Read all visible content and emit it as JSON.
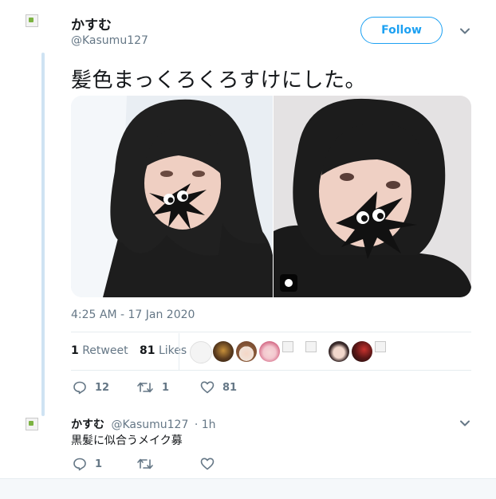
{
  "tweet": {
    "name": "かすむ",
    "handle": "@Kasumu127",
    "follow_label": "Follow",
    "text": "髪色まっくろくろすけにした。",
    "timestamp": "4:25 AM - 17 Jan 2020",
    "retweets_count": "1",
    "retweets_label": "Retweet",
    "likes_count": "81",
    "likes_label": "Likes",
    "replies": "12",
    "retweets": "1",
    "likes": "81"
  },
  "reply": {
    "name": "かすむ",
    "handle": "@Kasumu127",
    "time": "· 1h",
    "text": "黒髪に似合うメイク募",
    "replies": "1"
  },
  "colors": {
    "accent": "#1da1f2",
    "muted": "#657786",
    "text": "#14171a",
    "thread": "#cfe3f3"
  }
}
